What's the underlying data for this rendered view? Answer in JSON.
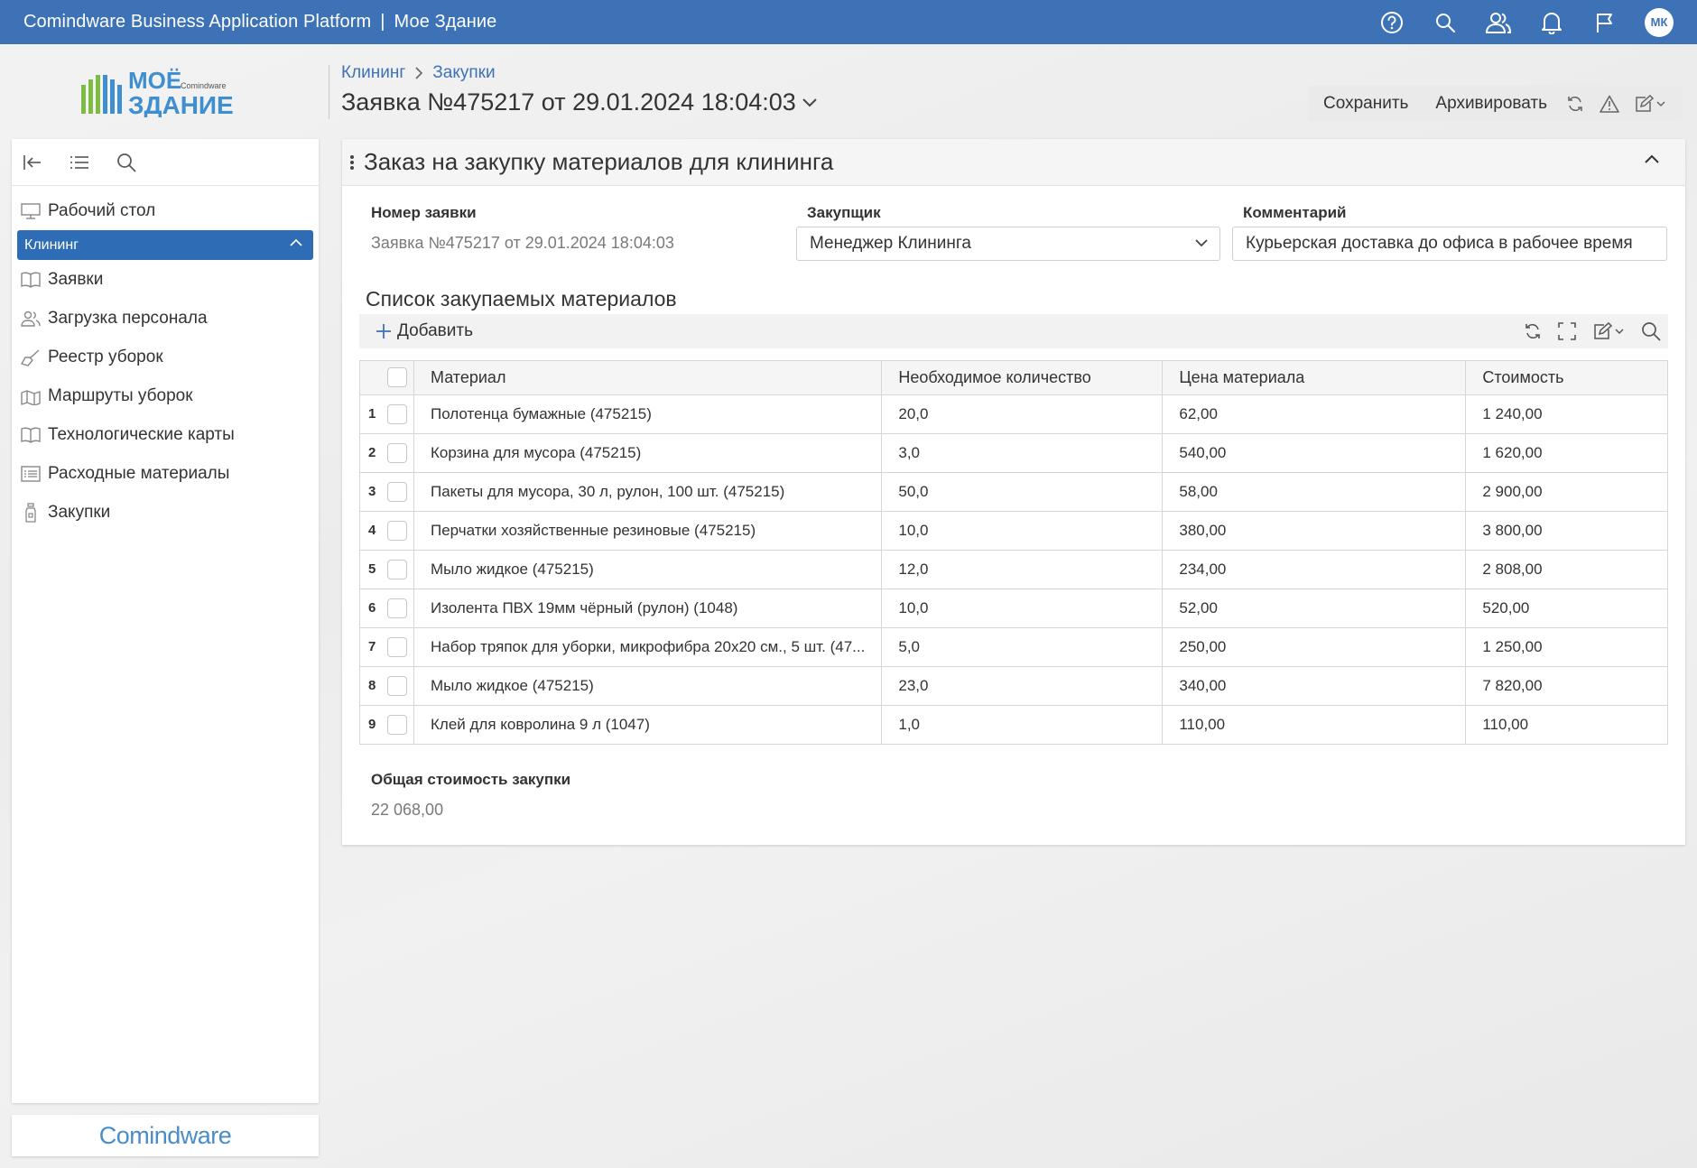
{
  "topbar": {
    "app_title": "Comindware Business Application Platform",
    "separator": "|",
    "workspace": "Мое Здание",
    "icons": [
      "help-icon",
      "search-icon",
      "users-icon",
      "bell-icon",
      "flag-icon"
    ],
    "avatar_initials": "МК",
    "color": "#3e72b6"
  },
  "logo": {
    "line1": "МОЁ",
    "line2": "ЗДАНИЕ",
    "small": "Comindware"
  },
  "breadcrumb": [
    "Клининг",
    "Закупки"
  ],
  "page_title": "Заявка №475217 от 29.01.2024 18:04:03",
  "actions": {
    "save": "Сохранить",
    "archive": "Архивировать",
    "icons": [
      "refresh-icon",
      "warning-icon",
      "edit-icon"
    ]
  },
  "sidebar": {
    "tools": [
      "collapse-left-icon",
      "list-icon",
      "search-icon"
    ],
    "items": [
      {
        "label": "Рабочий стол",
        "icon": "desktop-icon"
      },
      {
        "label": "Клининг",
        "group": true
      },
      {
        "label": "Заявки",
        "icon": "book-icon"
      },
      {
        "label": "Загрузка персонала",
        "icon": "people-icon"
      },
      {
        "label": "Реестр уборок",
        "icon": "broom-icon"
      },
      {
        "label": "Маршруты уборок",
        "icon": "map-icon"
      },
      {
        "label": "Технологические карты",
        "icon": "book-icon"
      },
      {
        "label": "Расходные материалы",
        "icon": "list-icon"
      },
      {
        "label": "Закупки",
        "icon": "bottle-icon"
      }
    ]
  },
  "brand_footer": "Comindware",
  "card": {
    "title": "Заказ на закупку материалов для клининга",
    "fields": {
      "number_label": "Номер заявки",
      "number_value": "Заявка №475217 от 29.01.2024 18:04:03",
      "buyer_label": "Закупщик",
      "buyer_value": "Менеджер Клининга",
      "comment_label": "Комментарий",
      "comment_value": "Курьерская доставка до офиса в рабочее время"
    },
    "list_title": "Список закупаемых материалов",
    "add_label": "Добавить",
    "grid_icons": [
      "refresh-icon",
      "fullscreen-icon",
      "edit-icon",
      "search-icon"
    ],
    "columns": [
      "Материал",
      "Необходимое количество",
      "Цена материала",
      "Стоимость"
    ],
    "rows": [
      {
        "n": "1",
        "material": "Полотенца бумажные (475215)",
        "qty": "20,0",
        "price": "62,00",
        "cost": "1 240,00"
      },
      {
        "n": "2",
        "material": "Корзина для мусора (475215)",
        "qty": "3,0",
        "price": "540,00",
        "cost": "1 620,00"
      },
      {
        "n": "3",
        "material": "Пакеты для мусора, 30 л, рулон, 100 шт. (475215)",
        "qty": "50,0",
        "price": "58,00",
        "cost": "2 900,00"
      },
      {
        "n": "4",
        "material": "Перчатки хозяйственные резиновые (475215)",
        "qty": "10,0",
        "price": "380,00",
        "cost": "3 800,00"
      },
      {
        "n": "5",
        "material": "Мыло жидкое (475215)",
        "qty": "12,0",
        "price": "234,00",
        "cost": "2 808,00"
      },
      {
        "n": "6",
        "material": "Изолента ПВХ 19мм чёрный (рулон) (1048)",
        "qty": "10,0",
        "price": "52,00",
        "cost": "520,00"
      },
      {
        "n": "7",
        "material": "Набор тряпок для уборки, микрофибра 20х20 см., 5 шт. (47...",
        "qty": "5,0",
        "price": "250,00",
        "cost": "1 250,00"
      },
      {
        "n": "8",
        "material": "Мыло жидкое (475215)",
        "qty": "23,0",
        "price": "340,00",
        "cost": "7 820,00"
      },
      {
        "n": "9",
        "material": "Клей для ковролина 9 л (1047)",
        "qty": "1,0",
        "price": "110,00",
        "cost": "110,00"
      }
    ],
    "total_label": "Общая стоимость закупки",
    "total_value": "22 068,00"
  }
}
